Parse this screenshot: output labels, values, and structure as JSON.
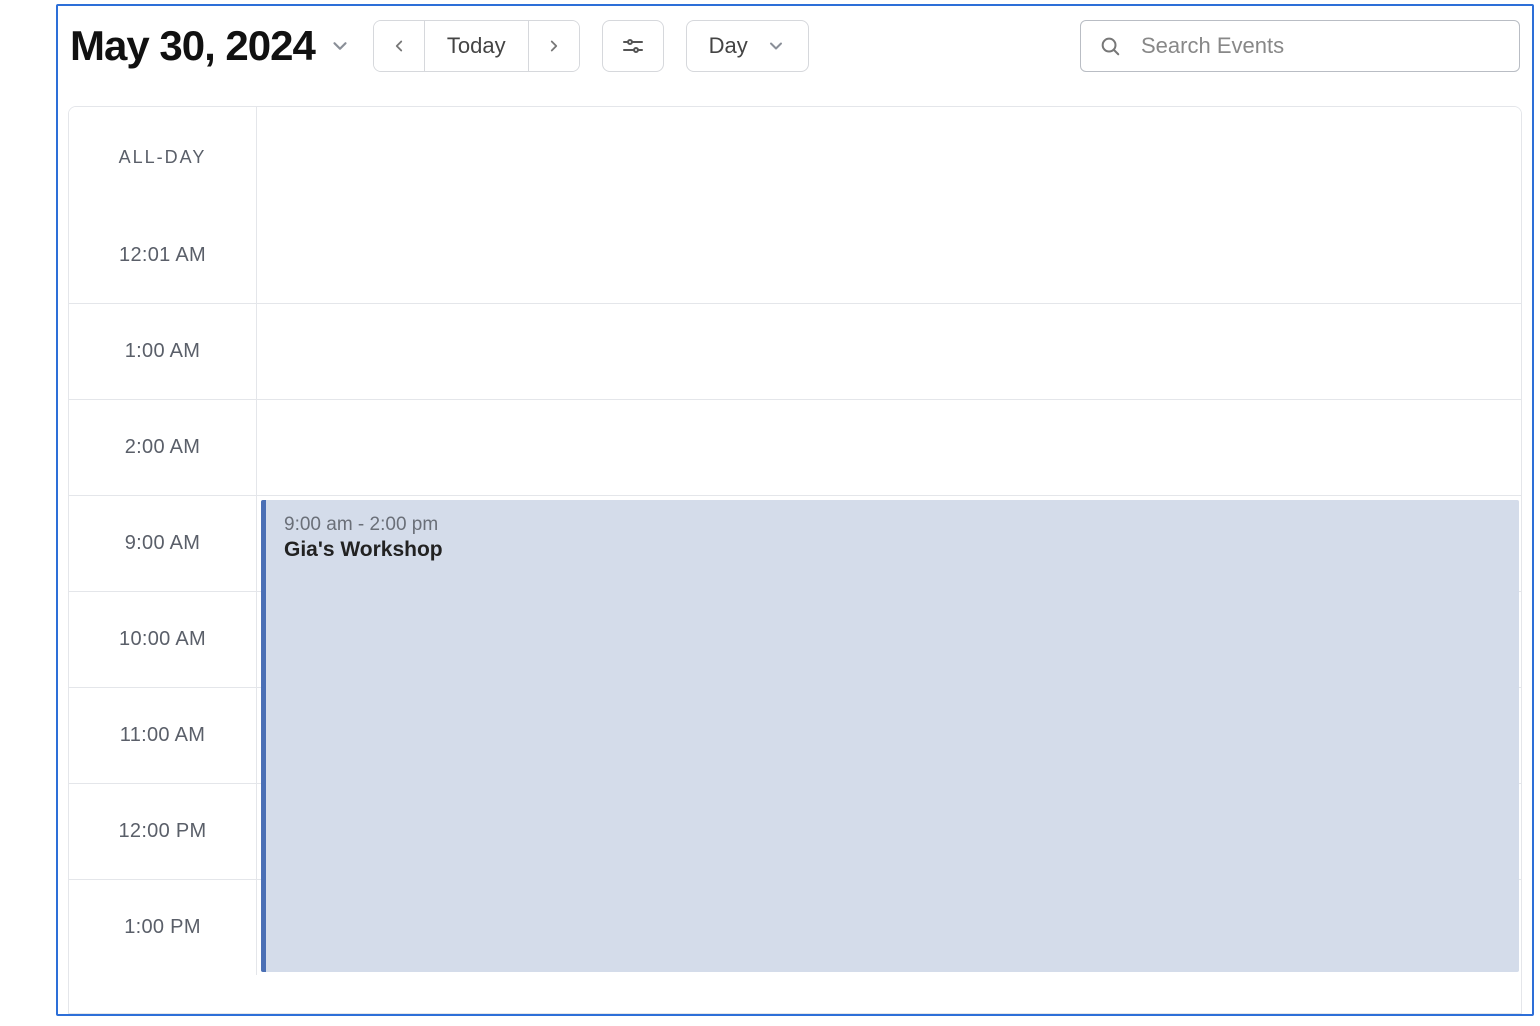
{
  "header": {
    "date_title": "May 30, 2024",
    "today_label": "Today",
    "view_label": "Day",
    "search_placeholder": "Search Events"
  },
  "time_labels": {
    "allday": "ALL-DAY",
    "slots": [
      "12:01 AM",
      "1:00 AM",
      "2:00 AM",
      "9:00 AM",
      "10:00 AM",
      "11:00 AM",
      "12:00 PM",
      "1:00 PM"
    ]
  },
  "event": {
    "time_range": "9:00 am - 2:00 pm",
    "title": "Gia's Workshop",
    "start_slot_index": 3,
    "span_slots": 5
  },
  "colors": {
    "event_bg": "#d4dcea",
    "event_accent": "#4a6fb5",
    "frame_border": "#2d6fd8"
  }
}
